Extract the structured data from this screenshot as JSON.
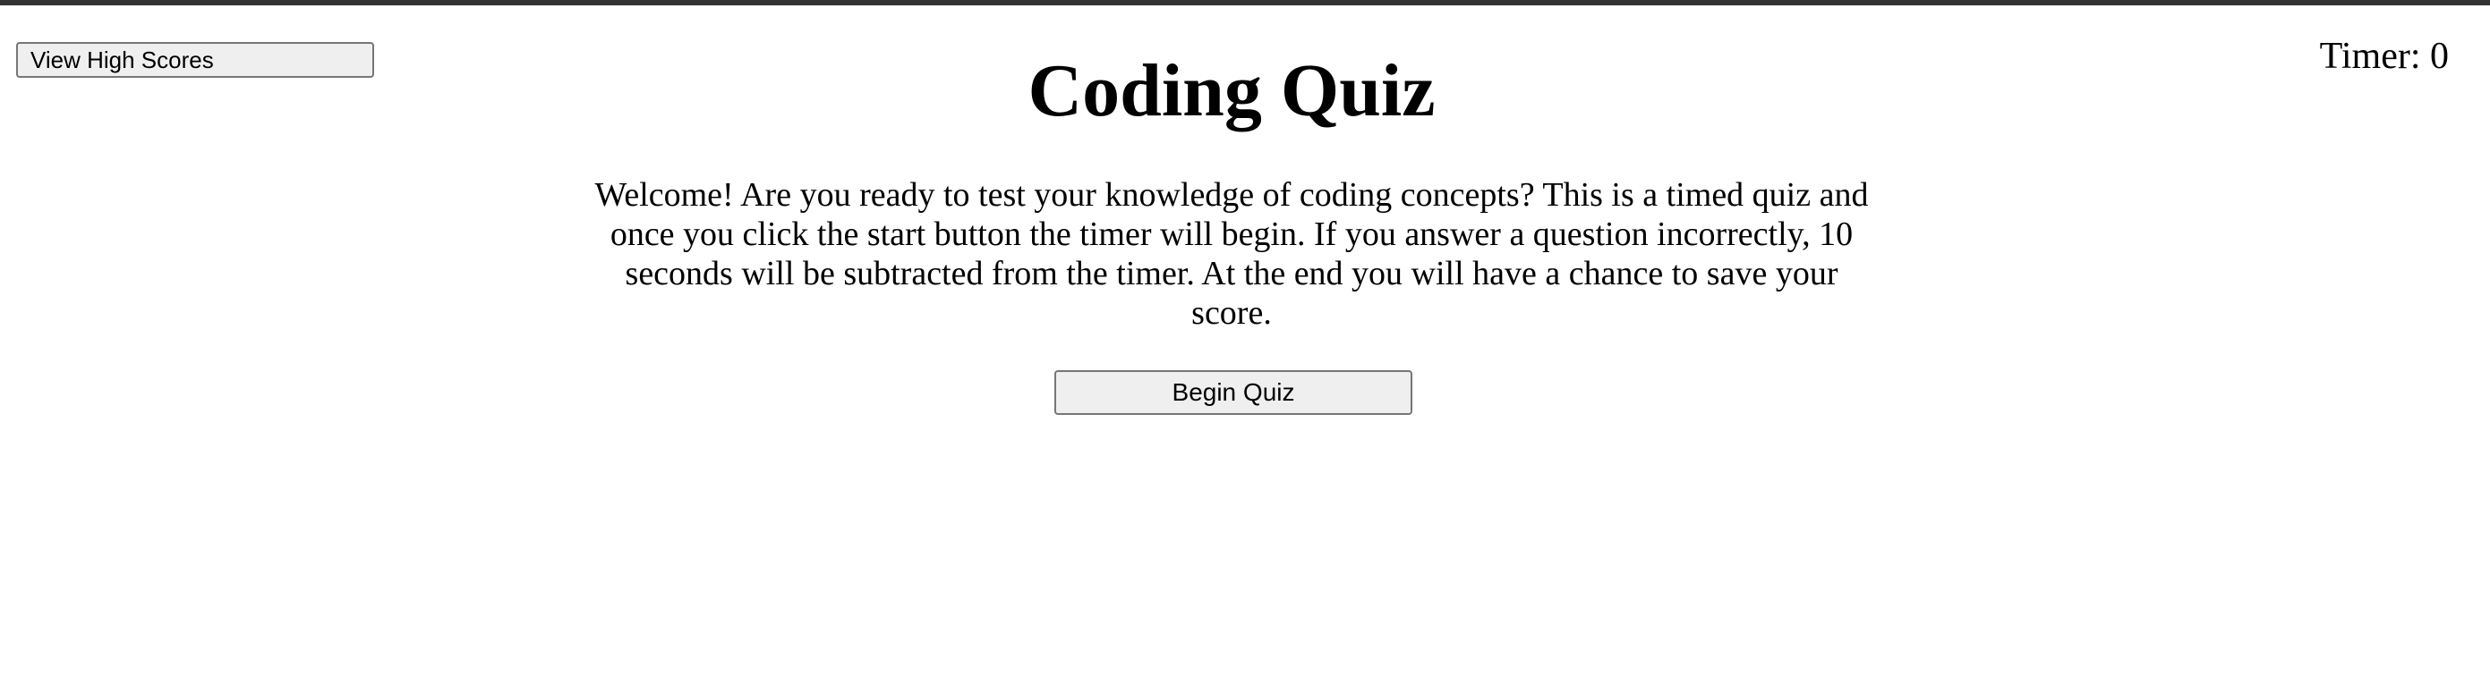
{
  "header": {
    "high_scores_label": "View High Scores",
    "timer_text": "Timer: 0"
  },
  "main": {
    "title": "Coding Quiz",
    "intro": "Welcome! Are you ready to test your knowledge of coding concepts? This is a timed quiz and once you click the start button the timer will begin. If you answer a question incorrectly, 10 seconds will be subtracted from the timer. At the end you will have a chance to save your score.",
    "begin_label": "Begin Quiz"
  },
  "colors": {
    "top_border": "#333333",
    "button_background": "#efefef",
    "button_border": "#767676",
    "text": "#000000",
    "page_background": "#ffffff"
  }
}
